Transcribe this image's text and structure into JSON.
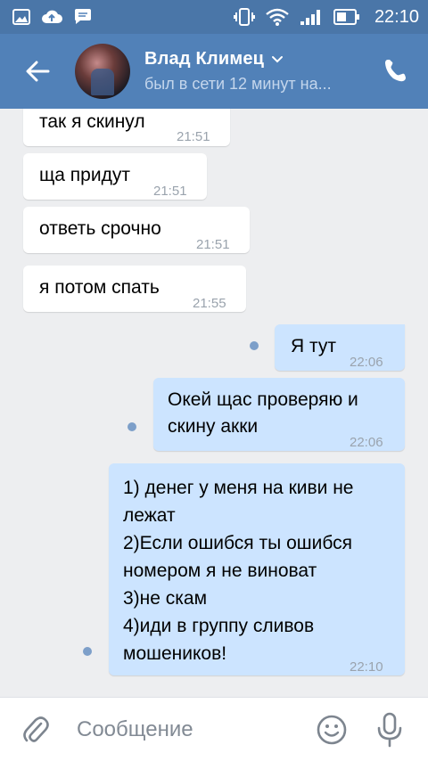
{
  "statusbar": {
    "time": "22:10",
    "icons": [
      "gallery-icon",
      "cloud-upload-icon",
      "chat-bubble-icon",
      "vibrate-icon",
      "wifi-icon",
      "signal-icon",
      "battery-icon"
    ]
  },
  "header": {
    "back_icon": "arrow-left-icon",
    "contact_name": "Влад Климец",
    "contact_status": "был в сети 12 минут на...",
    "call_icon": "phone-icon",
    "background": "#5181b8"
  },
  "messages": [
    {
      "direction": "in",
      "text": "так я скинул",
      "time": "21:51"
    },
    {
      "direction": "in",
      "text": "ща придут",
      "time": "21:51"
    },
    {
      "direction": "in",
      "text": "ответь срочно",
      "time": "21:51"
    },
    {
      "direction": "in",
      "text": "я потом спать",
      "time": "21:55"
    },
    {
      "direction": "out",
      "text": "Я тут",
      "time": "22:06",
      "unread": true
    },
    {
      "direction": "out",
      "lines": [
        "Окей щас проверяю и",
        "скину акки"
      ],
      "time": "22:06",
      "unread": true
    },
    {
      "direction": "out",
      "lines": [
        "1) денег у меня на киви не",
        "лежат",
        "2)Если ошибся ты ошибся",
        "номером я не виноват",
        "3)не скам",
        "4)иди в группу сливов",
        "мошеников!"
      ],
      "time": "22:10",
      "unread": true
    }
  ],
  "composer": {
    "placeholder": "Сообщение",
    "attach_icon": "paperclip-icon",
    "emoji_icon": "smile-icon",
    "mic_icon": "microphone-icon"
  },
  "colors": {
    "incoming_bubble": "#ffffff",
    "outgoing_bubble": "#cce4ff",
    "chat_background": "#edeef0",
    "unread_dot": "#7d9fc9"
  }
}
